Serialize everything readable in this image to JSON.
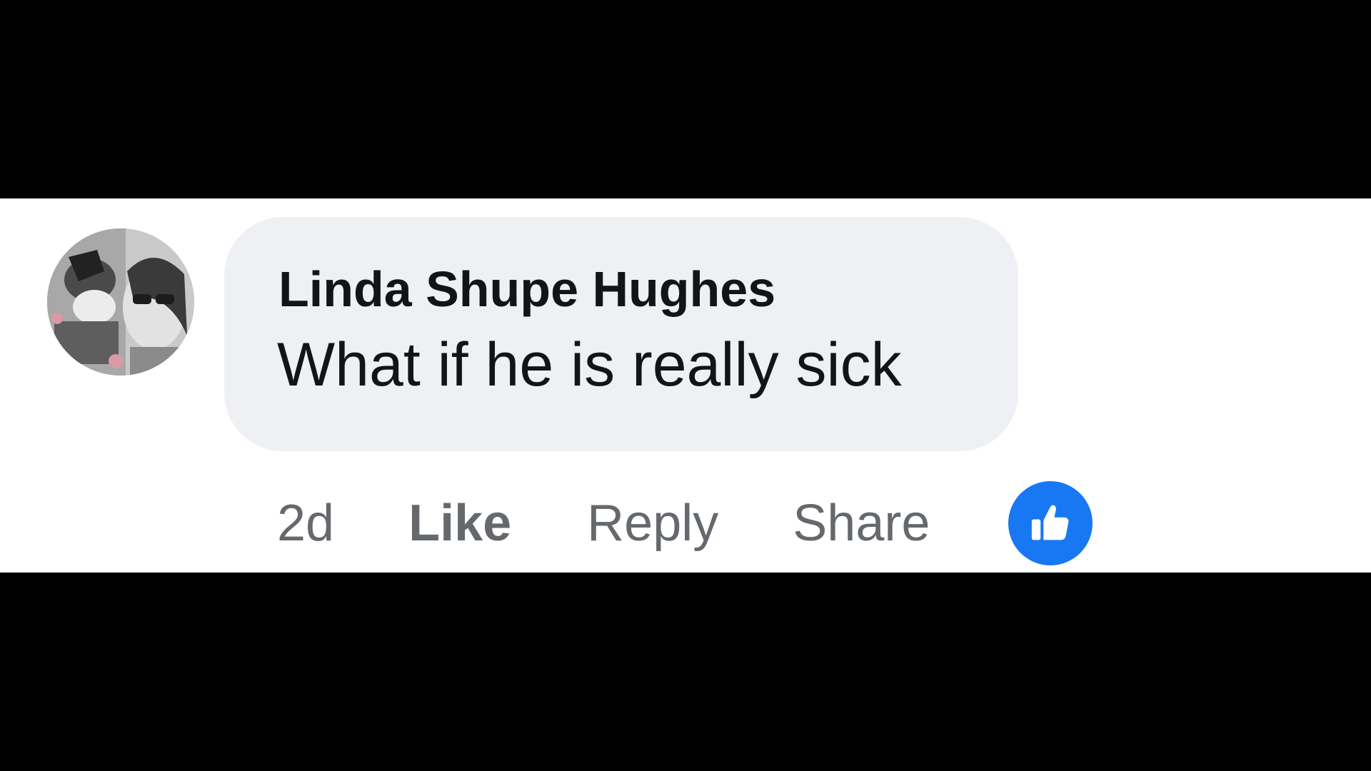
{
  "comment": {
    "author_name": "Linda Shupe Hughes",
    "text": "What if he is really sick",
    "avatar_icon": "profile-photo-avatar"
  },
  "actions": {
    "timestamp": "2d",
    "like_label": "Like",
    "reply_label": "Reply",
    "share_label": "Share"
  },
  "reaction": {
    "icon": "thumbs-up-icon",
    "color": "#1877f2"
  },
  "colors": {
    "bubble_background": "#eff0f3",
    "author_text": "#121417",
    "action_text": "#65686c",
    "letterbox": "#000000"
  }
}
